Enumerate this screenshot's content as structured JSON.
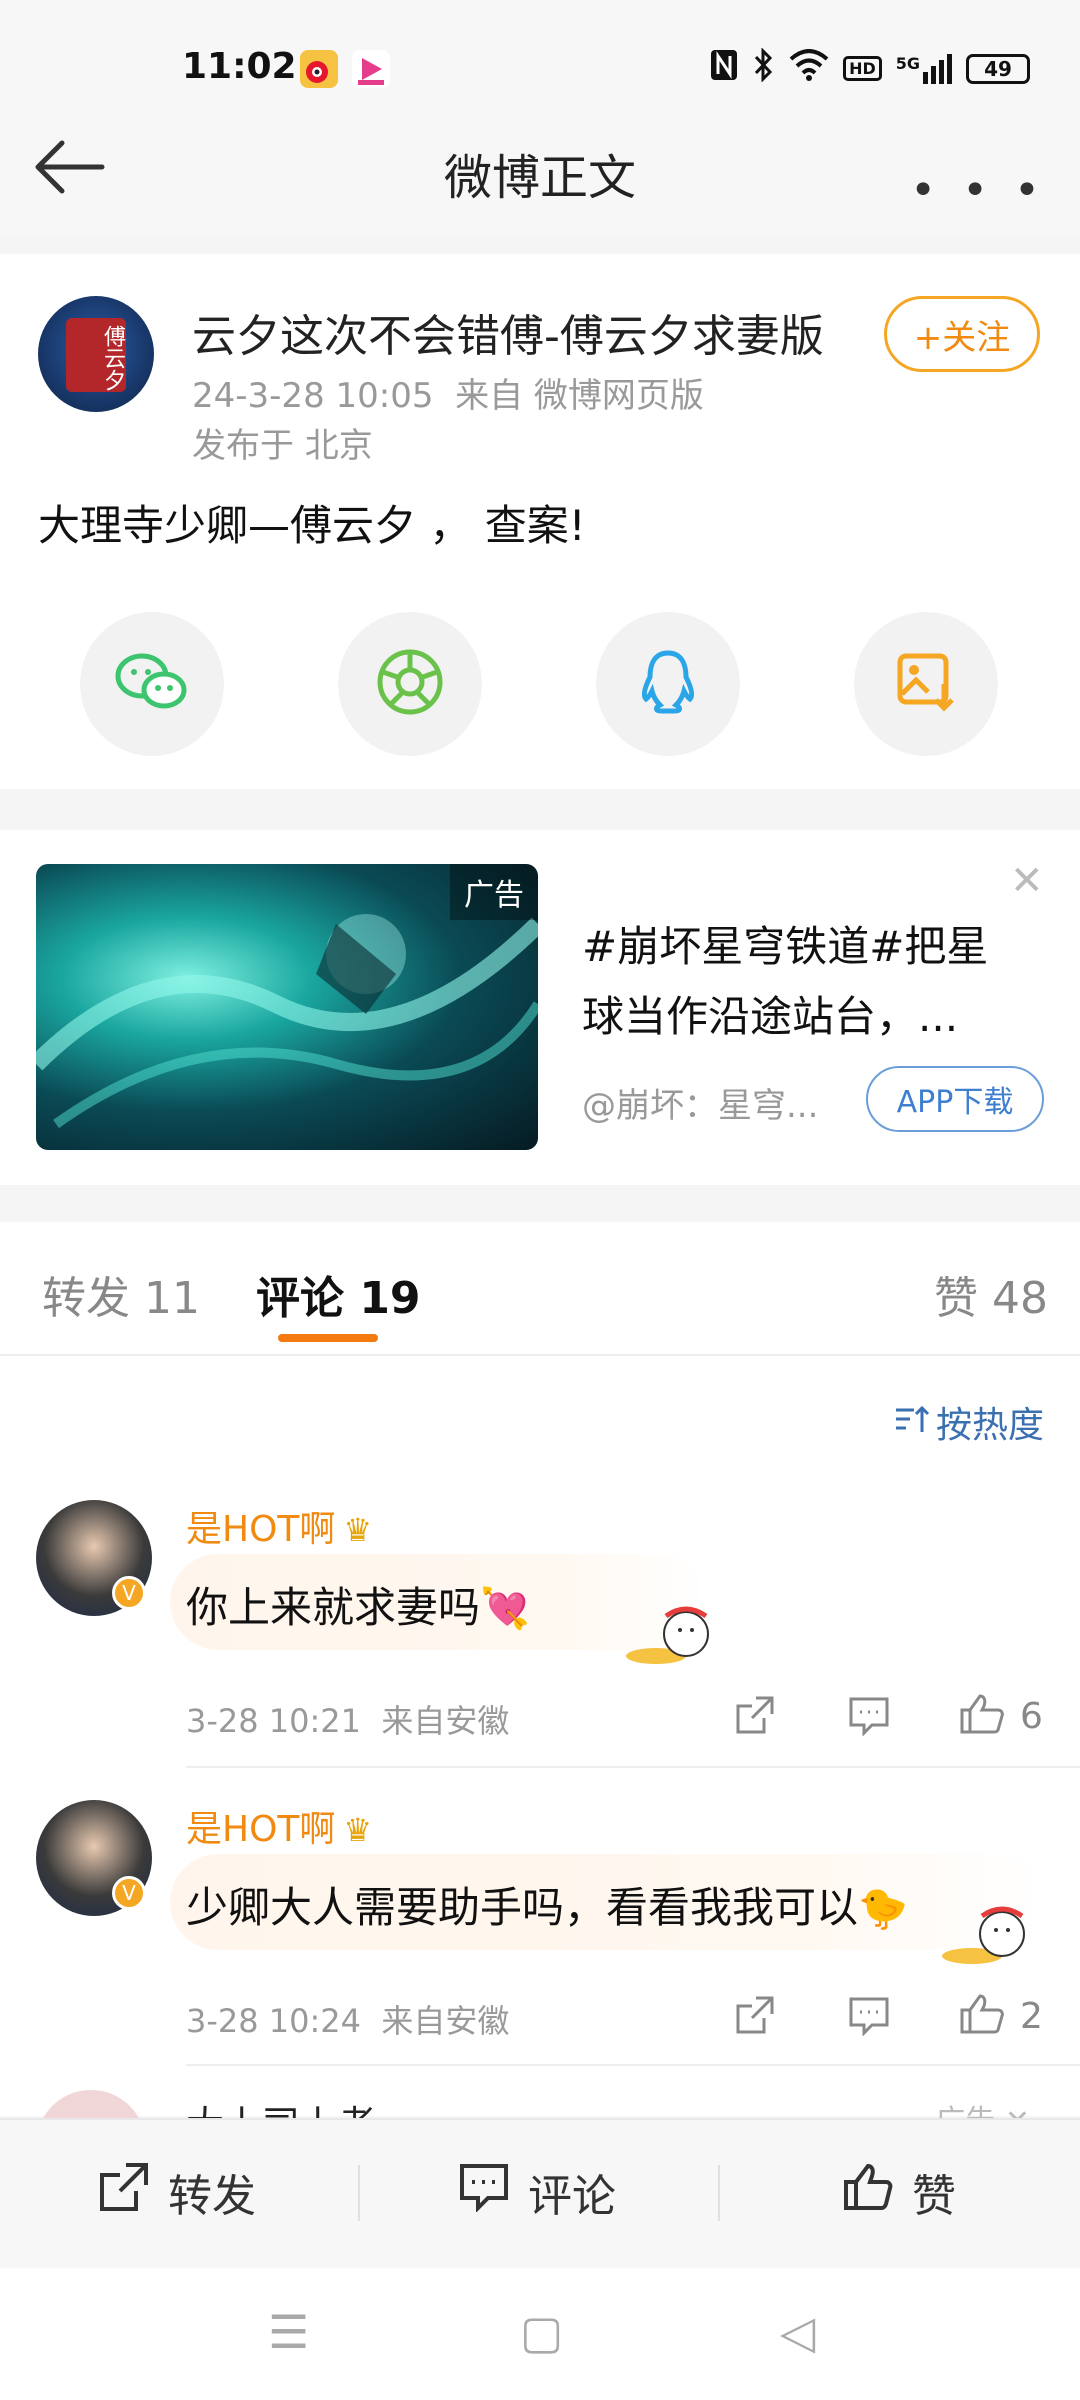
{
  "status_bar": {
    "time": "11:02",
    "battery": "49",
    "network": "5G",
    "hd": "HD",
    "icons": [
      "weibo-app-icon",
      "video-app-icon",
      "nfc-icon",
      "bluetooth-icon",
      "wifi-icon",
      "signal-icon"
    ]
  },
  "header": {
    "title": "微博正文",
    "more": "• • •"
  },
  "post": {
    "avatar_text": "傅云夕",
    "username": "云夕这次不会错傅-傅云夕求妻版",
    "meta_time": "24-3-28 10:05",
    "meta_source": "来自 微博网页版",
    "meta_location": "发布于 北京",
    "follow_label": "+关注",
    "text": "大理寺少卿—傅云夕 ， 查案!",
    "share_targets": [
      "wechat-icon",
      "moments-icon",
      "qq-icon",
      "save-image-icon"
    ]
  },
  "ad": {
    "tag": "广告",
    "title": "#崩坏星穹铁道#把星球当作沿途站台，...",
    "source": "@崩坏：星穹...",
    "button": "APP下载",
    "close": "✕"
  },
  "tabs": {
    "repost": "转发 11",
    "comment": "评论 19",
    "like": "赞 48"
  },
  "sort_label": "按热度",
  "comments": [
    {
      "name": "是HOT啊",
      "text": "你上来就求妻吗",
      "emoji": "💘",
      "time": "3-28 10:21",
      "location": "来自安徽",
      "likes": "6"
    },
    {
      "name": "是HOT啊",
      "text": "少卿大人需要助手吗，看看我我可以",
      "emoji": "🐤",
      "time": "3-28 10:24",
      "location": "来自安徽",
      "likes": "2"
    }
  ],
  "peek_comment": {
    "name": "大上司上者",
    "tag": "广告 ✕"
  },
  "bottom_bar": {
    "repost": "转发",
    "comment": "评论",
    "like": "赞"
  },
  "nav": {
    "menu": "☰",
    "home": "▢",
    "back": "◁"
  },
  "colors": {
    "accent": "#f08a10",
    "link": "#3a6fb0",
    "bg": "#f5f5f5"
  }
}
